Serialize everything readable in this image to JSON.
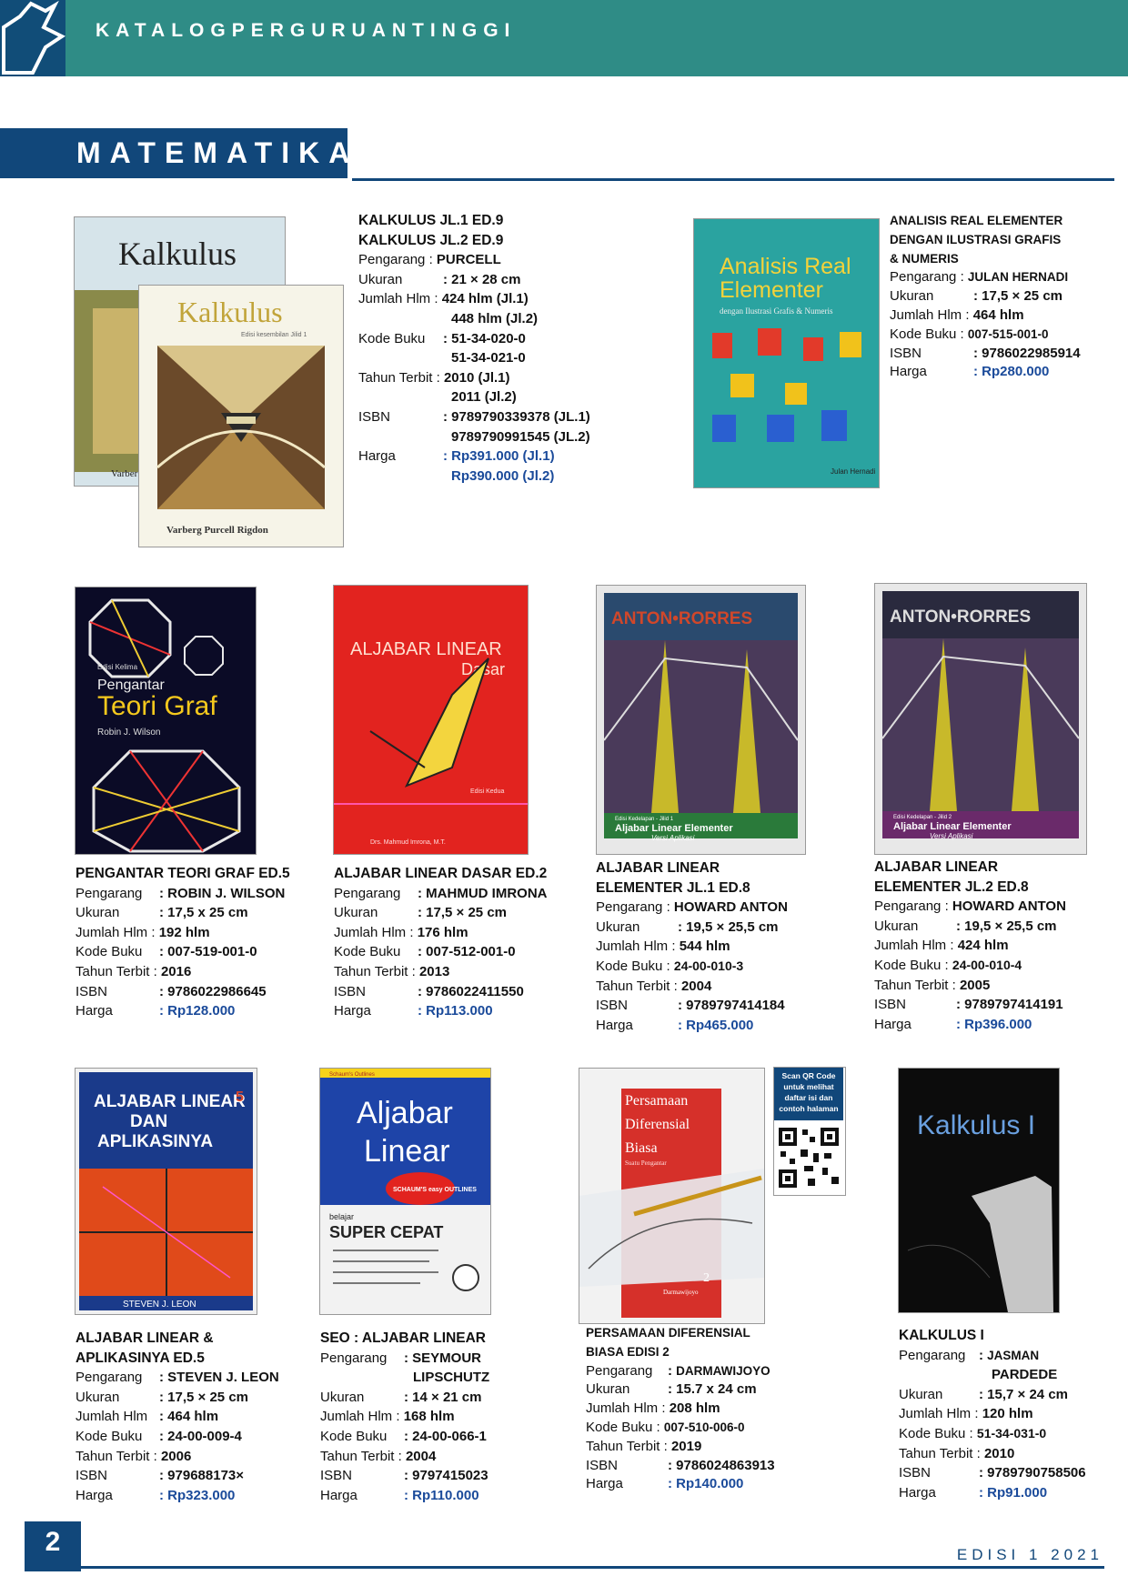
{
  "header": {
    "title": "KATALOGPERGURUANTINGGI"
  },
  "section": {
    "title": "MATEMATIKA"
  },
  "covers": {
    "kalkulus": {
      "title": "Kalkulus",
      "subtitle": "Edisi kesembilan Jilid 1",
      "authors": "Varberg   Purcell   Rigdon"
    },
    "analisis": {
      "title1": "Analisis Real",
      "title2": "Elementer",
      "sub": "dengan Ilustrasi Grafis & Numeris",
      "author": "Julan Hernadi"
    },
    "teori": {
      "edition": "Edisi Kelima",
      "title1": "Pengantar",
      "title2": "Teori Graf",
      "author": "Robin J. Wilson"
    },
    "aljdasar": {
      "title1": "ALJABAR LINEAR",
      "title2": "Dasar",
      "ed": "Edisi Kedua",
      "author": "Drs. Mahmud Imrona, M.T."
    },
    "anton1": {
      "brand": "ANTON•RORRES",
      "ed": "Edisi Kedelapan - Jilid 1",
      "title": "Aljabar Linear Elementer",
      "sub": "Versi Aplikasi"
    },
    "anton2": {
      "brand": "ANTON•RORRES",
      "ed": "Edisi Kedelapan - Jilid 2",
      "title": "Aljabar Linear Elementer",
      "sub": "Versi Aplikasi"
    },
    "leon": {
      "title1": "ALJABAR LINEAR",
      "title2": "DAN",
      "title3": "APLIKASINYA",
      "ed": "5",
      "author": "STEVEN J. LEON"
    },
    "seo": {
      "top": "Schaum's Outlines",
      "title1": "Aljabar",
      "title2": "Linear",
      "badge": "SCHAUM'S easy OUTLINES",
      "small": "belajar",
      "big": "SUPER CEPAT"
    },
    "pdb": {
      "title1": "Persamaan",
      "title2": "Diferensial",
      "title3": "Biasa",
      "sub": "Suatu Pengantar",
      "ed": "2",
      "author": "Darmawijoyo"
    },
    "kalkI": {
      "title": "Kalkulus I"
    }
  },
  "qr": {
    "note": "Scan QR Code untuk melihat daftar isi dan contoh halaman"
  },
  "books": [
    {
      "titles": [
        "KALKULUS JL.1 ED.9",
        "KALKULUS JL.2 ED.9"
      ],
      "rows": [
        [
          "Pengarang",
          "PURCELL"
        ],
        [
          "Ukuran",
          "21 × 28 cm"
        ],
        [
          "Jumlah Hlm",
          "424 hlm (Jl.1)"
        ],
        [
          "",
          "448 hlm (Jl.2)"
        ],
        [
          "Kode Buku",
          "51-34-020-0"
        ],
        [
          "",
          "51-34-021-0"
        ],
        [
          "Tahun Terbit",
          "2010 (Jl.1)"
        ],
        [
          "",
          "2011 (Jl.2)"
        ],
        [
          "ISBN",
          "9789790339378 (JL.1)"
        ],
        [
          "",
          "9789790991545 (JL.2)"
        ],
        [
          "Harga",
          "Rp391.000 (Jl.1)"
        ],
        [
          "",
          "Rp390.000 (Jl.2)"
        ]
      ]
    },
    {
      "titles": [
        "ANALISIS REAL ELEMENTER",
        "DENGAN ILUSTRASI GRAFIS",
        "& NUMERIS"
      ],
      "rows": [
        [
          "Pengarang",
          "JULAN HERNADI"
        ],
        [
          "Ukuran",
          "17,5 × 25 cm"
        ],
        [
          "Jumlah Hlm",
          "464 hlm"
        ],
        [
          "Kode Buku",
          "007-515-001-0"
        ],
        [
          "ISBN",
          "9786022985914"
        ],
        [
          "Harga",
          "Rp280.000"
        ]
      ]
    },
    {
      "titles": [
        "PENGANTAR TEORI GRAF ED.5"
      ],
      "rows": [
        [
          "Pengarang",
          "ROBIN J. WILSON"
        ],
        [
          "Ukuran",
          "17,5 x 25 cm"
        ],
        [
          "Jumlah Hlm",
          "192 hlm"
        ],
        [
          "Kode Buku",
          "007-519-001-0"
        ],
        [
          "Tahun Terbit",
          "2016"
        ],
        [
          "ISBN",
          "9786022986645"
        ],
        [
          "Harga",
          "Rp128.000"
        ]
      ]
    },
    {
      "titles": [
        "ALJABAR LINEAR DASAR ED.2"
      ],
      "rows": [
        [
          "Pengarang",
          "MAHMUD IMRONA"
        ],
        [
          "Ukuran",
          "17,5 × 25 cm"
        ],
        [
          "Jumlah Hlm",
          "176 hlm"
        ],
        [
          "Kode Buku",
          "007-512-001-0"
        ],
        [
          "Tahun Terbit",
          "2013"
        ],
        [
          "ISBN",
          "9786022411550"
        ],
        [
          "Harga",
          "Rp113.000"
        ]
      ]
    },
    {
      "titles": [
        "ALJABAR LINEAR",
        "ELEMENTER JL.1 ED.8"
      ],
      "rows": [
        [
          "Pengarang",
          "HOWARD ANTON"
        ],
        [
          "Ukuran",
          "19,5 × 25,5 cm"
        ],
        [
          "Jumlah Hlm",
          "544 hlm"
        ],
        [
          "Kode Buku",
          "24-00-010-3"
        ],
        [
          "Tahun Terbit",
          "2004"
        ],
        [
          "ISBN",
          "9789797414184"
        ],
        [
          "Harga",
          "Rp465.000"
        ]
      ]
    },
    {
      "titles": [
        "ALJABAR LINEAR",
        "ELEMENTER JL.2 ED.8"
      ],
      "rows": [
        [
          "Pengarang",
          "HOWARD ANTON"
        ],
        [
          "Ukuran",
          "19,5 × 25,5 cm"
        ],
        [
          "Jumlah Hlm",
          "424 hlm"
        ],
        [
          "Kode Buku",
          "24-00-010-4"
        ],
        [
          "Tahun Terbit",
          "2005"
        ],
        [
          "ISBN",
          "9789797414191"
        ],
        [
          "Harga",
          "Rp396.000"
        ]
      ]
    },
    {
      "titles": [
        "ALJABAR LINEAR &",
        "APLIKASINYA ED.5"
      ],
      "rows": [
        [
          "Pengarang",
          "STEVEN J. LEON"
        ],
        [
          "Ukuran",
          "17,5 × 25 cm"
        ],
        [
          "Jumlah Hlm",
          "464 hlm"
        ],
        [
          "Kode Buku",
          "24-00-009-4"
        ],
        [
          "Tahun Terbit",
          "2006"
        ],
        [
          "ISBN",
          "979688173×"
        ],
        [
          "Harga",
          "Rp323.000"
        ]
      ]
    },
    {
      "titles": [
        "SEO : ALJABAR LINEAR"
      ],
      "rows": [
        [
          "Pengarang",
          "SEYMOUR"
        ],
        [
          "",
          "LIPSCHUTZ"
        ],
        [
          "Ukuran",
          "14 × 21 cm"
        ],
        [
          "Jumlah Hlm",
          "168 hlm"
        ],
        [
          "Kode Buku",
          "24-00-066-1"
        ],
        [
          "Tahun Terbit",
          "2004"
        ],
        [
          "ISBN",
          "9797415023"
        ],
        [
          "Harga",
          "Rp110.000"
        ]
      ]
    },
    {
      "titles": [
        "PERSAMAAN DIFERENSIAL",
        "BIASA EDISI 2"
      ],
      "rows": [
        [
          "Pengarang",
          "DARMAWIJOYO"
        ],
        [
          "Ukuran",
          "15.7 x 24 cm"
        ],
        [
          "Jumlah Hlm",
          "208 hlm"
        ],
        [
          "Kode Buku",
          "007-510-006-0"
        ],
        [
          "Tahun Terbit",
          "2019"
        ],
        [
          "ISBN",
          "9786024863913"
        ],
        [
          "Harga",
          "Rp140.000"
        ]
      ]
    },
    {
      "titles": [
        "KALKULUS I"
      ],
      "rows": [
        [
          "Pengarang",
          "JASMAN"
        ],
        [
          "",
          "PARDEDE"
        ],
        [
          "Ukuran",
          "15,7 × 24 cm"
        ],
        [
          "Jumlah Hlm",
          "120 hlm"
        ],
        [
          "Kode Buku",
          "51-34-031-0"
        ],
        [
          "Tahun Terbit",
          "2010"
        ],
        [
          "ISBN",
          "9789790758506"
        ],
        [
          "Harga",
          "Rp91.000"
        ]
      ]
    }
  ],
  "footer": {
    "page": "2",
    "edition": "EDISI 1 2021"
  }
}
